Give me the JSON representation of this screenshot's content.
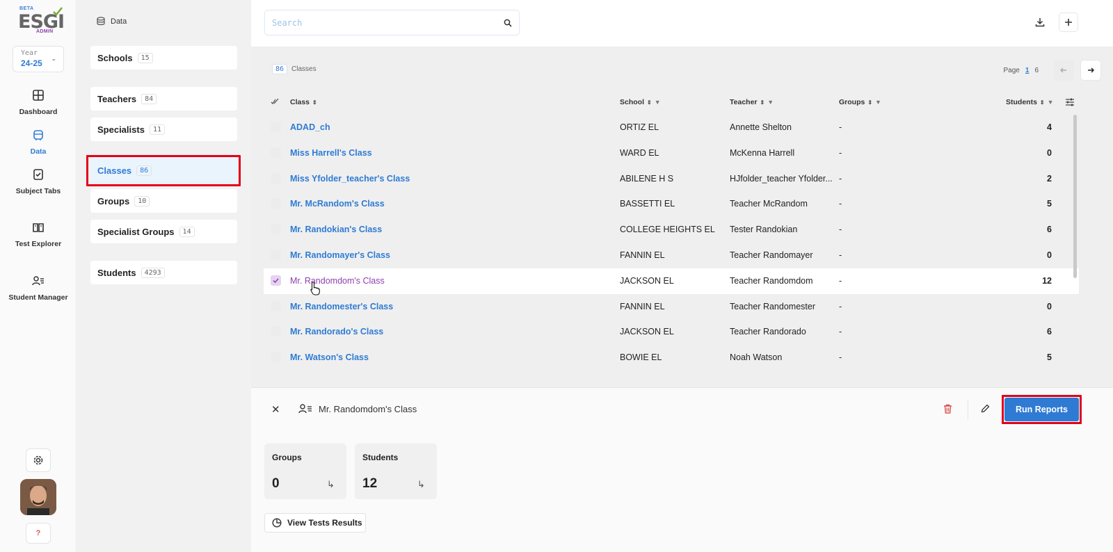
{
  "logo": {
    "beta": "BETA",
    "name": "ESGI",
    "sub": "ADMIN"
  },
  "year": {
    "label": "Year",
    "value": "24-25"
  },
  "rail": [
    {
      "label": "Dashboard",
      "icon": "grid-icon"
    },
    {
      "label": "Data",
      "icon": "database-icon",
      "active": true
    },
    {
      "label": "Subject Tabs",
      "icon": "checklist-icon"
    },
    {
      "label": "Test Explorer",
      "icon": "book-icon"
    },
    {
      "label": "Student Manager",
      "icon": "user-list-icon"
    }
  ],
  "help": {
    "label": "?"
  },
  "datanav": {
    "header": "Data",
    "items": [
      {
        "label": "Schools",
        "count": "15"
      },
      {
        "label": "Teachers",
        "count": "84"
      },
      {
        "label": "Specialists",
        "count": "11"
      },
      {
        "label": "Classes",
        "count": "86"
      },
      {
        "label": "Groups",
        "count": "10"
      },
      {
        "label": "Specialist Groups",
        "count": "14"
      },
      {
        "label": "Students",
        "count": "4293"
      }
    ]
  },
  "search": {
    "placeholder": "Search"
  },
  "list": {
    "count": "86",
    "count_label": "Classes"
  },
  "pager": {
    "label": "Page",
    "current": "1",
    "total": "6"
  },
  "table": {
    "headers": {
      "class": "Class",
      "school": "School",
      "teacher": "Teacher",
      "groups": "Groups",
      "students": "Students"
    },
    "rows": [
      {
        "class": "ADAD_ch",
        "school": "ORTIZ EL",
        "teacher": "Annette Shelton",
        "groups": "-",
        "students": "4"
      },
      {
        "class": "Miss Harrell's Class",
        "school": "WARD EL",
        "teacher": "McKenna Harrell",
        "groups": "-",
        "students": "0"
      },
      {
        "class": "Miss Yfolder_teacher's Class",
        "school": "ABILENE H S",
        "teacher": "HJfolder_teacher Yfolder...",
        "groups": "-",
        "students": "2"
      },
      {
        "class": "Mr. McRandom's Class",
        "school": "BASSETTI EL",
        "teacher": "Teacher McRandom",
        "groups": "-",
        "students": "5"
      },
      {
        "class": "Mr. Randokian's Class",
        "school": "COLLEGE HEIGHTS EL",
        "teacher": "Tester Randokian",
        "groups": "-",
        "students": "6"
      },
      {
        "class": "Mr. Randomayer's Class",
        "school": "FANNIN EL",
        "teacher": "Teacher Randomayer",
        "groups": "-",
        "students": "0"
      },
      {
        "class": "Mr. Randomdom's Class",
        "school": "JACKSON EL",
        "teacher": "Teacher Randomdom",
        "groups": "-",
        "students": "12"
      },
      {
        "class": "Mr. Randomester's Class",
        "school": "FANNIN EL",
        "teacher": "Teacher Randomester",
        "groups": "-",
        "students": "0"
      },
      {
        "class": "Mr. Randorado's Class",
        "school": "JACKSON EL",
        "teacher": "Teacher Randorado",
        "groups": "-",
        "students": "6"
      },
      {
        "class": "Mr. Watson's Class",
        "school": "BOWIE EL",
        "teacher": "Noah Watson",
        "groups": "-",
        "students": "5"
      }
    ]
  },
  "detail": {
    "title": "Mr. Randomdom's Class",
    "run_reports": "Run Reports",
    "groups_label": "Groups",
    "groups_value": "0",
    "students_label": "Students",
    "students_value": "12",
    "view_tests": "View Tests Results"
  },
  "colors": {
    "accent": "#2f7bd4",
    "selected": "#8e3fb0",
    "highlight": "#e0001b",
    "danger": "#d9534f"
  }
}
